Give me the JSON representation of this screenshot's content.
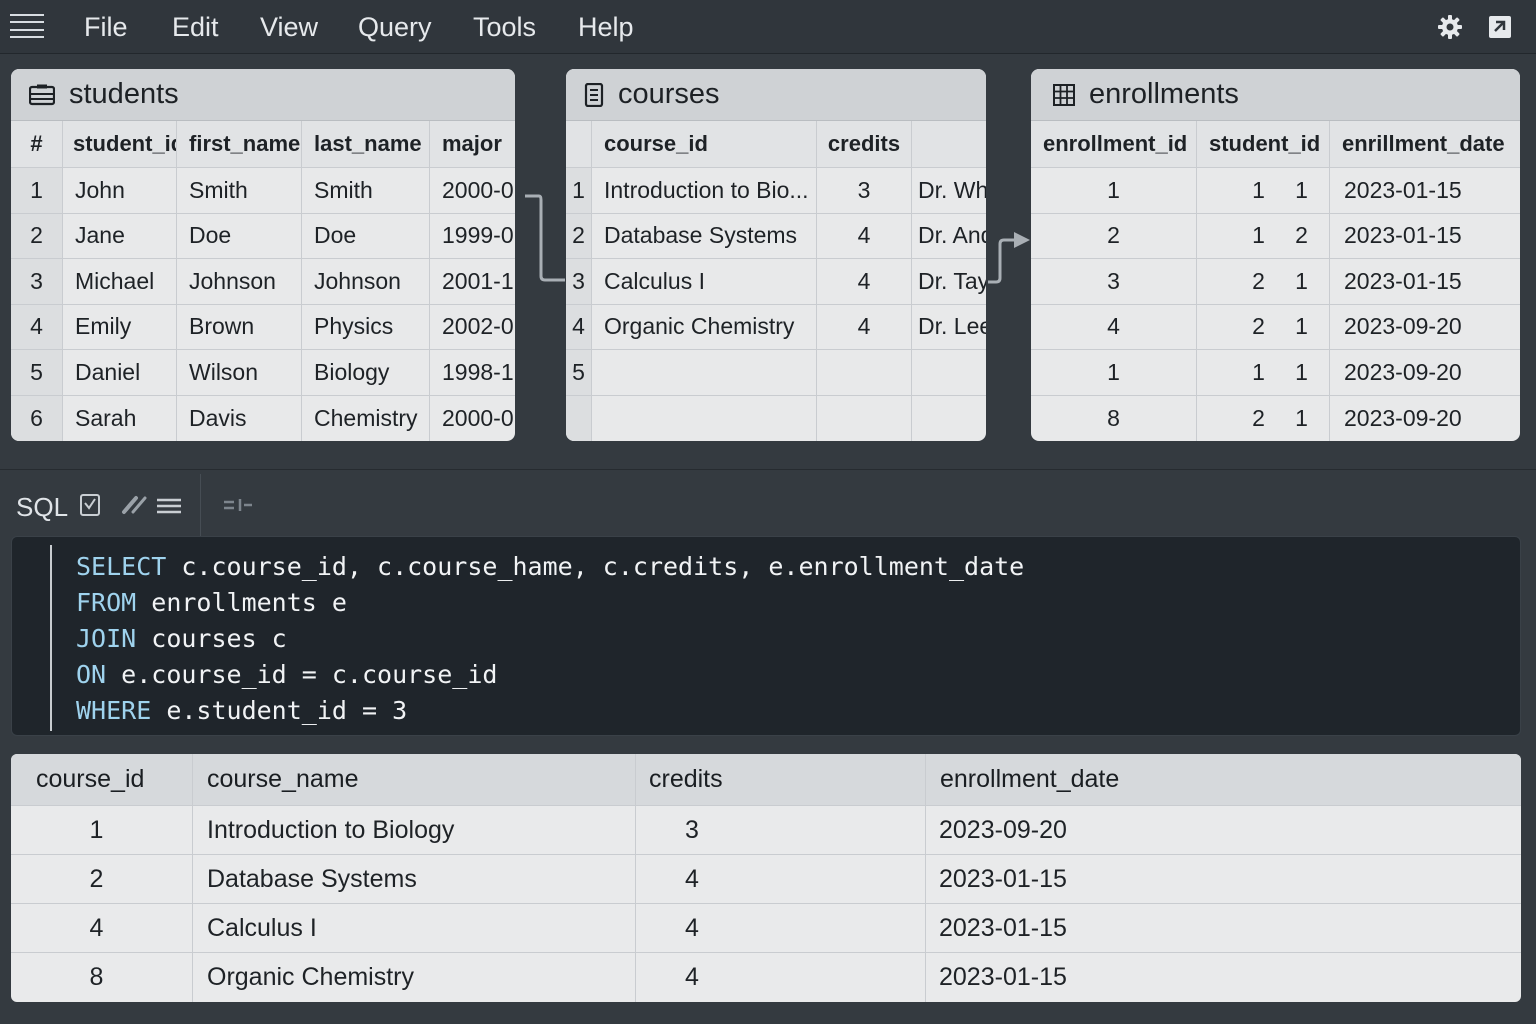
{
  "menu": {
    "items": [
      "File",
      "Edit",
      "View",
      "Query",
      "Tools",
      "Help"
    ]
  },
  "tables": {
    "students": {
      "title": "students",
      "columns": [
        "#",
        "student_id",
        "first_name",
        "last_name",
        "major"
      ],
      "rows": [
        [
          "1",
          "John",
          "Smith",
          "Smith",
          "2000-0"
        ],
        [
          "2",
          "Jane",
          "Doe",
          "Doe",
          "1999-0"
        ],
        [
          "3",
          "Michael",
          "Johnson",
          "Johnson",
          "2001-1"
        ],
        [
          "4",
          "Emily",
          "Brown",
          "Physics",
          "2002-0"
        ],
        [
          "5",
          "Daniel",
          "Wilson",
          "Biology",
          "1998-1"
        ],
        [
          "6",
          "Sarah",
          "Davis",
          "Chemistry",
          "2000-0"
        ]
      ]
    },
    "courses": {
      "title": "courses",
      "columns": [
        "",
        "course_id",
        "credits",
        ""
      ],
      "rows": [
        [
          "1",
          "Introduction to Bio...",
          "3",
          "Dr. Wh"
        ],
        [
          "2",
          "Database Systems",
          "4",
          "Dr. And"
        ],
        [
          "3",
          "Calculus I",
          "4",
          "Dr. Tay"
        ],
        [
          "4",
          "Organic Chemistry",
          "4",
          "Dr. Lee"
        ],
        [
          "5",
          "",
          "",
          ""
        ],
        [
          "",
          "",
          "",
          ""
        ]
      ]
    },
    "enrollments": {
      "title": "enrollments",
      "columns": [
        "enrollment_id",
        "student_id",
        "enrillment_date"
      ],
      "rows": [
        [
          "1",
          "1",
          "1",
          "2023-01-15"
        ],
        [
          "2",
          "1",
          "2",
          "2023-01-15"
        ],
        [
          "3",
          "2",
          "1",
          "2023-01-15"
        ],
        [
          "4",
          "2",
          "1",
          "2023-09-20"
        ],
        [
          "1",
          "1",
          "1",
          "2023-09-20"
        ],
        [
          "8",
          "2",
          "1",
          "2023-09-20"
        ]
      ]
    }
  },
  "sql": {
    "label": "SQL",
    "lines": [
      {
        "kw": "SELECT",
        "rest": " c.course_id, c.course_hame, c.credits, e.enrollment_date"
      },
      {
        "kw": "FROM",
        "rest": " enrollments e"
      },
      {
        "kw": "JOIN",
        "rest": " courses c"
      },
      {
        "kw": "ON",
        "rest": " e.course_id = c.course_id"
      },
      {
        "kw": "WHERE",
        "rest": " e.student_id = 3"
      }
    ]
  },
  "result": {
    "columns": [
      "course_id",
      "course_name",
      "credits",
      "enrollment_date"
    ],
    "rows": [
      [
        "1",
        "Introduction to Biology",
        "3",
        "2023-09-20"
      ],
      [
        "2",
        "Database Systems",
        "4",
        "2023-01-15"
      ],
      [
        "4",
        "Calculus I",
        "4",
        "2023-01-15"
      ],
      [
        "8",
        "Organic Chemistry",
        "4",
        "2023-01-15"
      ]
    ]
  },
  "icons": {
    "menu": "hamburger-icon",
    "settings": "gear-icon",
    "export": "export-icon",
    "students": "table-icon",
    "courses": "list-icon",
    "enrollments": "grid-icon",
    "toolbar": [
      "checkbox-icon",
      "edit-icon",
      "format-icon",
      "indent-icon"
    ]
  },
  "colors": {
    "background": "#343a40",
    "panel": "#e8e9ea",
    "editor": "#1f252b",
    "keyword": "#9fd3ee"
  }
}
